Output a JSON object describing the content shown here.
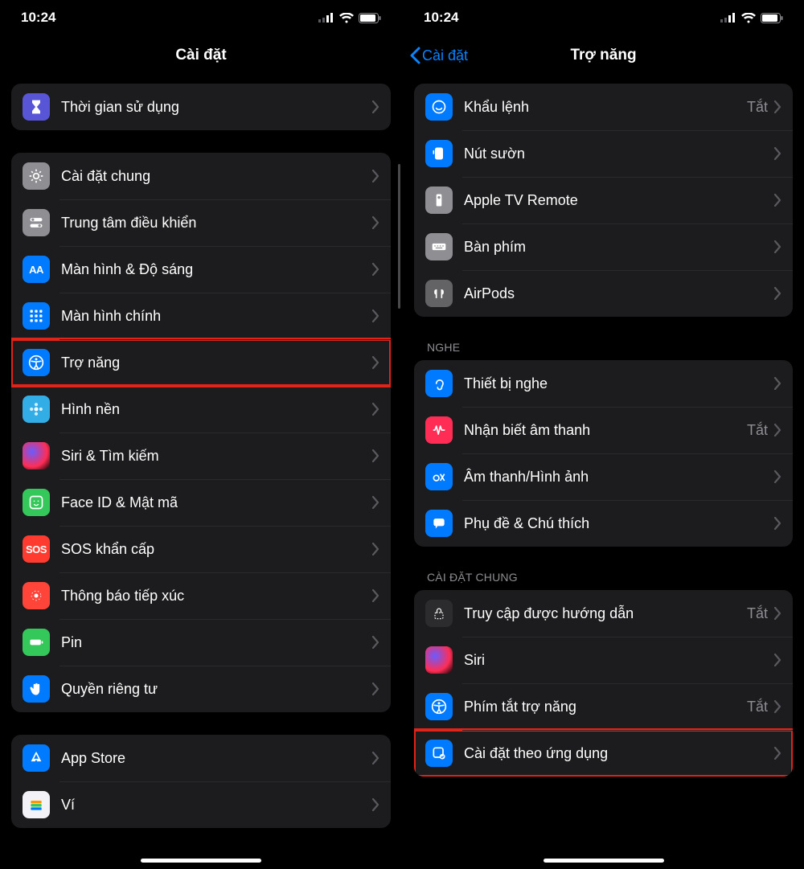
{
  "status": {
    "time": "10:24"
  },
  "left": {
    "title": "Cài đặt",
    "group_top": [
      {
        "id": "screentime",
        "label": "Thời gian sử dụng",
        "icon": "hourglass",
        "bg": "bg-purple"
      }
    ],
    "group_main": [
      {
        "id": "general",
        "label": "Cài đặt chung",
        "icon": "gear",
        "bg": "bg-gray"
      },
      {
        "id": "control",
        "label": "Trung tâm điều khiển",
        "icon": "switches",
        "bg": "bg-gray"
      },
      {
        "id": "display",
        "label": "Màn hình & Độ sáng",
        "icon": "AA",
        "bg": "bg-blue"
      },
      {
        "id": "home",
        "label": "Màn hình chính",
        "icon": "grid",
        "bg": "bg-bluehs"
      },
      {
        "id": "access",
        "label": "Trợ năng",
        "icon": "access",
        "bg": "bg-blue",
        "highlight": true
      },
      {
        "id": "wallpaper",
        "label": "Hình nền",
        "icon": "flower",
        "bg": "bg-cyan"
      },
      {
        "id": "siri",
        "label": "Siri & Tìm kiếm",
        "icon": "siri",
        "bg": "bg-siri"
      },
      {
        "id": "faceid",
        "label": "Face ID & Mật mã",
        "icon": "faceid",
        "bg": "bg-green"
      },
      {
        "id": "sos",
        "label": "SOS khẩn cấp",
        "icon": "SOS",
        "bg": "bg-red"
      },
      {
        "id": "exposure",
        "label": "Thông báo tiếp xúc",
        "icon": "dots",
        "bg": "bg-red2"
      },
      {
        "id": "battery",
        "label": "Pin",
        "icon": "battery",
        "bg": "bg-green"
      },
      {
        "id": "privacy",
        "label": "Quyền riêng tư",
        "icon": "hand",
        "bg": "bg-blue"
      }
    ],
    "group_store": [
      {
        "id": "appstore",
        "label": "App Store",
        "icon": "appstore",
        "bg": "bg-blue"
      },
      {
        "id": "wallet",
        "label": "Ví",
        "icon": "wallet",
        "bg": "bg-white"
      }
    ]
  },
  "right": {
    "back": "Cài đặt",
    "title": "Trợ năng",
    "group_ctrl": [
      {
        "id": "voicectl",
        "label": "Khẩu lệnh",
        "icon": "voice",
        "bg": "bg-blue",
        "value": "Tắt"
      },
      {
        "id": "sidebtn",
        "label": "Nút sườn",
        "icon": "side",
        "bg": "bg-blue"
      },
      {
        "id": "tvremote",
        "label": "Apple TV Remote",
        "icon": "remote",
        "bg": "bg-gray"
      },
      {
        "id": "keyboards",
        "label": "Bàn phím",
        "icon": "kbd",
        "bg": "bg-gray"
      },
      {
        "id": "airpods",
        "label": "AirPods",
        "icon": "airpods",
        "bg": "bg-grayd"
      }
    ],
    "header_hear": "NGHE",
    "group_hear": [
      {
        "id": "hearing",
        "label": "Thiết bị nghe",
        "icon": "ear",
        "bg": "bg-blue"
      },
      {
        "id": "soundrec",
        "label": "Nhận biết âm thanh",
        "icon": "wave",
        "bg": "bg-pink",
        "value": "Tắt"
      },
      {
        "id": "av",
        "label": "Âm thanh/Hình ảnh",
        "icon": "av",
        "bg": "bg-blue"
      },
      {
        "id": "captions",
        "label": "Phụ đề & Chú thích",
        "icon": "speech",
        "bg": "bg-blue"
      }
    ],
    "header_gen": "CÀI ĐẶT CHUNG",
    "group_gen": [
      {
        "id": "guided",
        "label": "Truy cập được hướng dẫn",
        "icon": "lock",
        "bg": "bg-dark",
        "value": "Tắt"
      },
      {
        "id": "sirir",
        "label": "Siri",
        "icon": "siri",
        "bg": "bg-siri"
      },
      {
        "id": "shortcut",
        "label": "Phím tắt trợ năng",
        "icon": "access",
        "bg": "bg-blue",
        "value": "Tắt"
      },
      {
        "id": "perapp",
        "label": "Cài đặt theo ứng dụng",
        "icon": "perapp",
        "bg": "bg-blue",
        "highlight": true
      }
    ]
  }
}
